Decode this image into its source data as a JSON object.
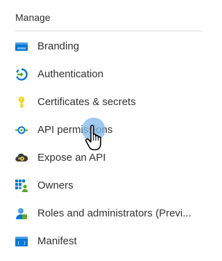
{
  "section": {
    "title": "Manage"
  },
  "menu": {
    "items": [
      {
        "label": "Branding",
        "icon": "branding-icon"
      },
      {
        "label": "Authentication",
        "icon": "authentication-icon"
      },
      {
        "label": "Certificates & secrets",
        "icon": "key-icon"
      },
      {
        "label": "API permissions",
        "icon": "api-permissions-icon"
      },
      {
        "label": "Expose an API",
        "icon": "cloud-gear-icon"
      },
      {
        "label": "Owners",
        "icon": "owners-icon"
      },
      {
        "label": "Roles and administrators (Previ...",
        "icon": "roles-icon"
      },
      {
        "label": "Manifest",
        "icon": "manifest-icon"
      }
    ]
  },
  "colors": {
    "text": "#323130",
    "divider": "#e1dfdd",
    "azure_blue": "#0078d4",
    "green": "#5ea829",
    "key_yellow": "#fcd116",
    "cursor_highlight": "#7fb7e8"
  }
}
